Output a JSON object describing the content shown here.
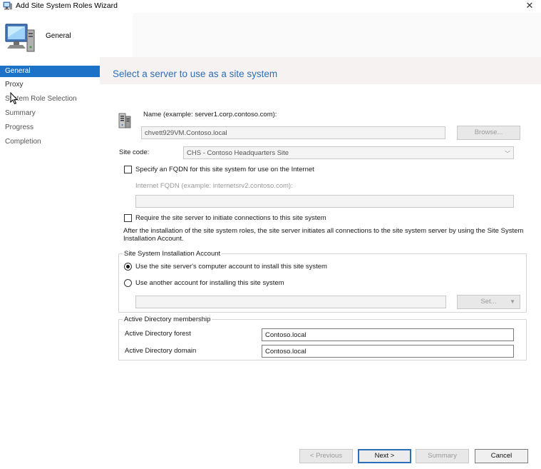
{
  "window": {
    "title": "Add Site System Roles Wizard",
    "close_glyph": "✕"
  },
  "header": {
    "title": "General"
  },
  "nav": {
    "items": [
      {
        "label": "General",
        "state": "active"
      },
      {
        "label": "Proxy",
        "state": "normal"
      },
      {
        "label": "System Role Selection",
        "state": "dim"
      },
      {
        "label": "Summary",
        "state": "dim"
      },
      {
        "label": "Progress",
        "state": "dim"
      },
      {
        "label": "Completion",
        "state": "dim"
      }
    ]
  },
  "page": {
    "heading": "Select a server to use as a site system"
  },
  "server": {
    "name_label": "Name (example: server1.corp.contoso.com):",
    "name_value": "chvett929VM.Contoso.local",
    "browse_label": "Browse...",
    "site_code_label": "Site code:",
    "site_code_value": "CHS - Contoso Headquarters Site"
  },
  "fqdn": {
    "checkbox_label": "Specify an FQDN for this site system for use on the Internet",
    "checked": false,
    "field_label": "Internet FQDN (example: internetsrv2.contoso.com):",
    "field_value": ""
  },
  "initiate": {
    "checkbox_label": "Require the site server to initiate connections to this site system",
    "checked": false,
    "description": "After the  installation of the site system roles, the site server initiates all connections to the site system server by using the Site System Installation Account."
  },
  "install_account": {
    "group_title": "Site System Installation Account",
    "option_computer": "Use the site server's computer account to install this site system",
    "option_other": "Use another account for installing this site system",
    "selected": "computer",
    "account_value": "",
    "set_label": "Set..."
  },
  "active_directory": {
    "group_title": "Active Directory membership",
    "forest_label": "Active Directory forest",
    "forest_value": "Contoso.local",
    "domain_label": "Active Directory domain",
    "domain_value": "Contoso.local"
  },
  "footer": {
    "previous_label": "< Previous",
    "next_label": "Next >",
    "summary_label": "Summary",
    "cancel_label": "Cancel"
  },
  "colors": {
    "accent": "#1b72c6",
    "heading": "#2a6fb8"
  }
}
